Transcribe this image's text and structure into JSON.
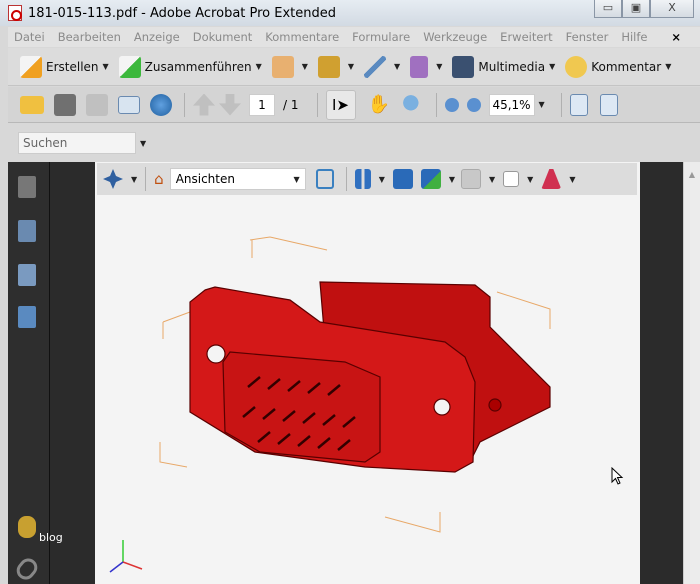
{
  "window": {
    "title": "181-015-113.pdf - Adobe Acrobat Pro Extended",
    "minimize": "▭",
    "maximize": "▣",
    "close": "X"
  },
  "menu": {
    "items": [
      "Datei",
      "Bearbeiten",
      "Anzeige",
      "Dokument",
      "Kommentare",
      "Formulare",
      "Werkzeuge",
      "Erweitert",
      "Fenster",
      "Hilfe"
    ],
    "close": "×"
  },
  "toolbar1": {
    "create": "Erstellen",
    "combine": "Zusammenführen",
    "multimedia": "Multimedia",
    "comment": "Kommentar"
  },
  "toolbar2": {
    "page_current": "1",
    "page_total": "/ 1",
    "zoom": "45,1%"
  },
  "toolbar3": {
    "search_placeholder": "Suchen"
  },
  "toolbar3d": {
    "views": "Ansichten"
  },
  "sidebar": {
    "blog_label": "blog"
  },
  "colors": {
    "model": "#d01010",
    "accent": "#e0a050"
  }
}
